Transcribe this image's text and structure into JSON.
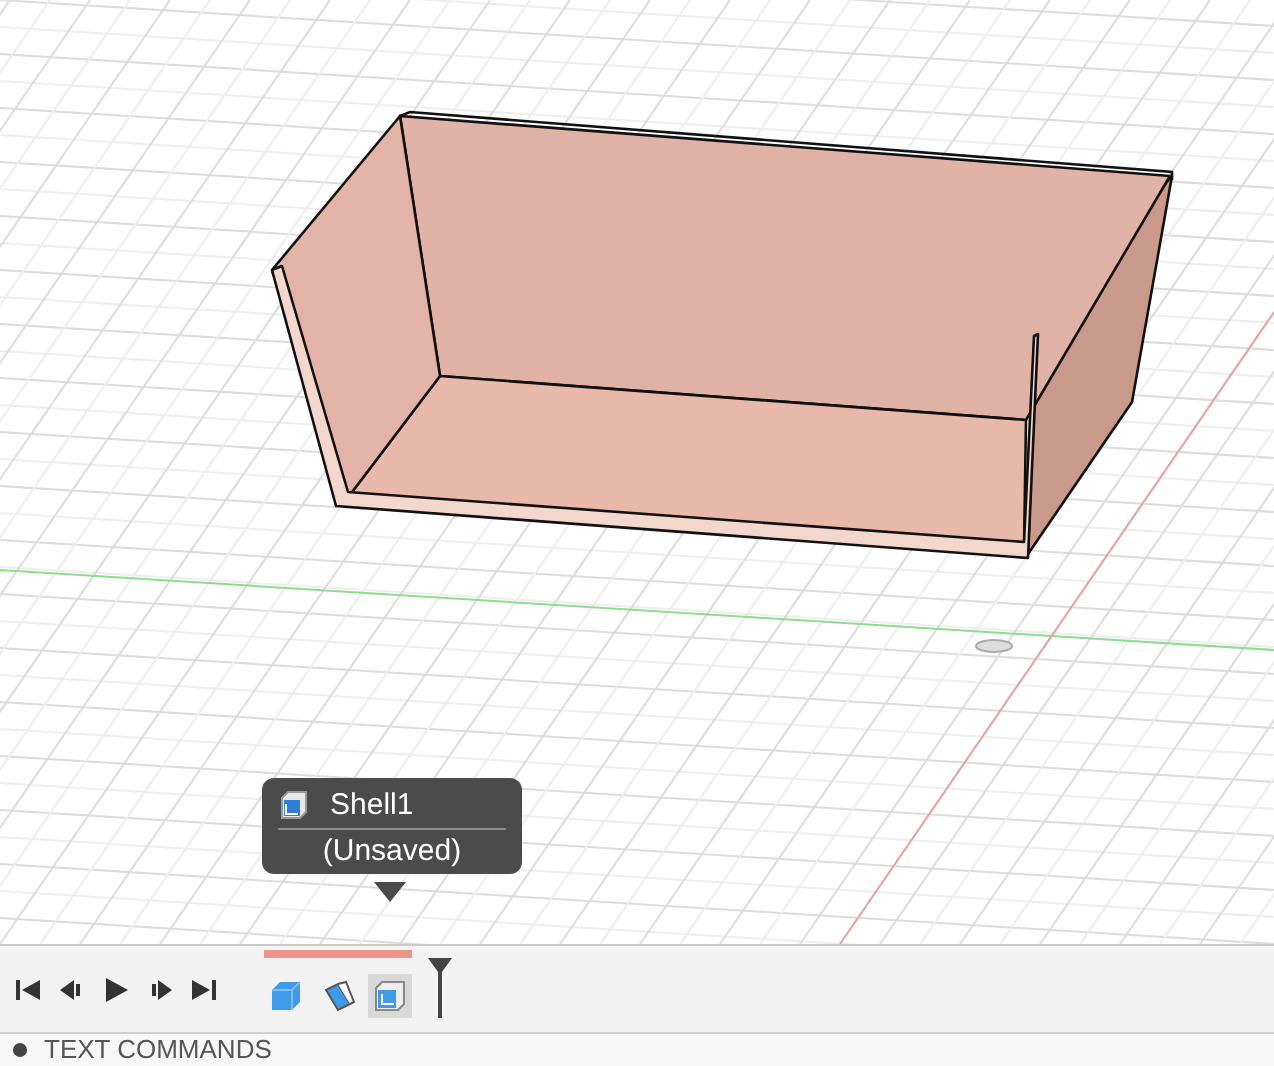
{
  "viewport": {
    "tooltip": {
      "title": "Shell1",
      "subtitle": "(Unsaved)"
    }
  },
  "timeline": {
    "features": [
      {
        "kind": "box",
        "selected": false
      },
      {
        "kind": "form",
        "selected": false
      },
      {
        "kind": "shell",
        "selected": true
      }
    ]
  },
  "text_commands": {
    "label": "TEXT COMMANDS"
  }
}
